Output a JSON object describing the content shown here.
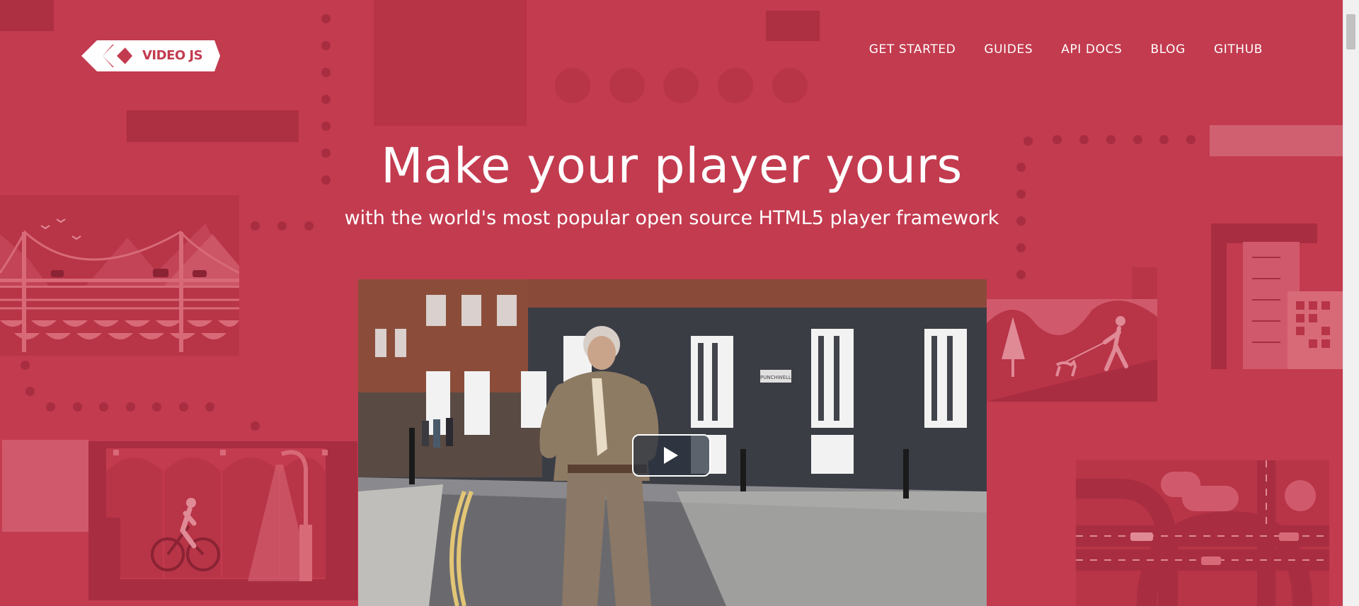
{
  "logo": {
    "text": "VIDEO JS"
  },
  "nav": {
    "items": [
      {
        "label": "GET STARTED"
      },
      {
        "label": "GUIDES"
      },
      {
        "label": "API DOCS"
      },
      {
        "label": "BLOG"
      },
      {
        "label": "GITHUB"
      }
    ]
  },
  "hero": {
    "title": "Make your player yours",
    "subtitle": "with the world's most popular open source HTML5 player framework"
  },
  "video": {
    "play_icon": "play-icon",
    "street_sign": "PUNCHWELL"
  },
  "colors": {
    "background": "#c33b4f",
    "dark_shape": "#ad2f42",
    "light_shape": "#d0606f",
    "text": "#ffffff"
  }
}
